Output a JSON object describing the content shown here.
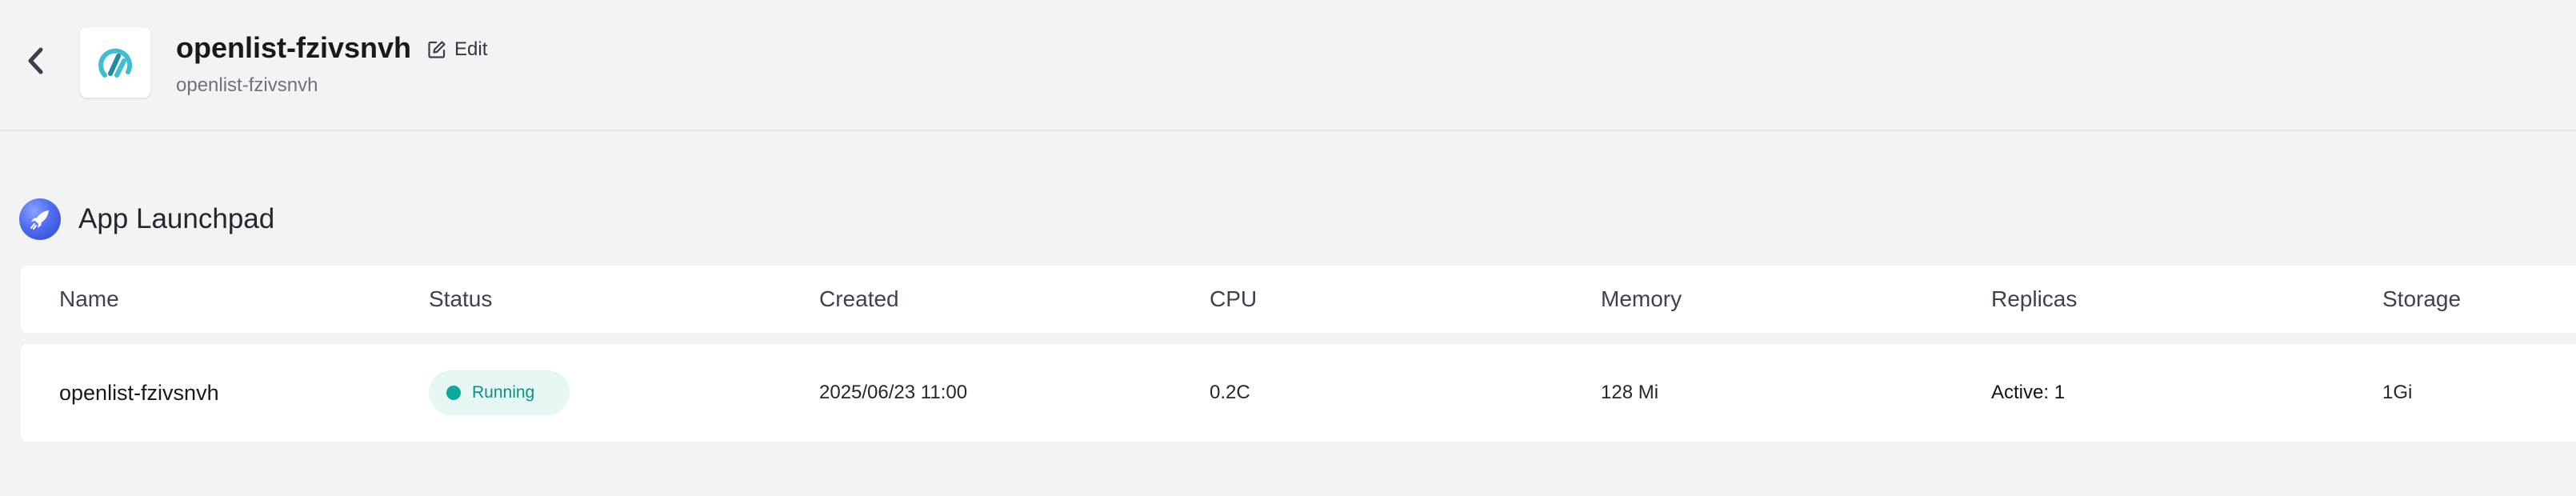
{
  "header": {
    "title": "openlist-fzivsnvh",
    "subtitle": "openlist-fzivsnvh",
    "edit_label": "Edit"
  },
  "section": {
    "title": "App Launchpad"
  },
  "table": {
    "columns": [
      "Name",
      "Status",
      "Created",
      "CPU",
      "Memory",
      "Replicas",
      "Storage"
    ],
    "rows": [
      {
        "name": "openlist-fzivsnvh",
        "status": "Running",
        "created": "2025/06/23 11:00",
        "cpu": "0.2C",
        "memory": "128 Mi",
        "replicas": "Active: 1",
        "storage": "1Gi"
      }
    ]
  },
  "colors": {
    "background": "#f2f3f5",
    "status_running_bg": "#e6f6f4",
    "status_running_fg": "#0e9184",
    "status_dot": "#0aa99a",
    "logo_teal": "#3bbfd1",
    "launchpad_blue": "#4f6cf0"
  },
  "icons": {
    "back": "chevron-left-icon",
    "logo": "openlist-logo",
    "edit": "edit-icon",
    "section": "rocket-icon"
  }
}
